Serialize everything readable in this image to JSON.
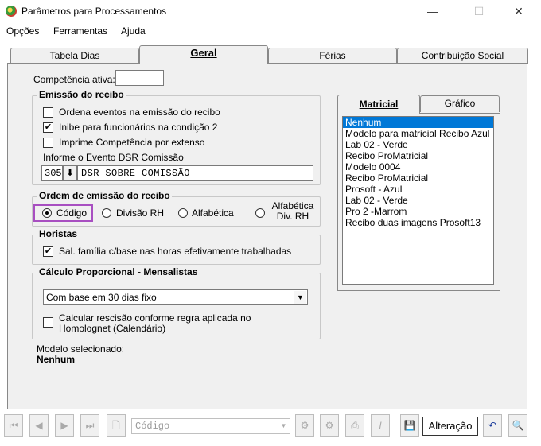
{
  "window": {
    "title": "Parâmetros para Processamentos",
    "minimize": "—",
    "maximize": "☐",
    "close": "✕"
  },
  "menu": [
    "Opções",
    "Ferramentas",
    "Ajuda"
  ],
  "tabs": [
    {
      "label": "Tabela Dias",
      "active": false
    },
    {
      "label": "Geral",
      "active": true
    },
    {
      "label": "Férias",
      "active": false
    },
    {
      "label": "Contribuição Social",
      "active": false
    }
  ],
  "competencia": {
    "label": "Competência ativa:",
    "value": ""
  },
  "emissao": {
    "title": "Emissão do recibo",
    "options": [
      {
        "label": "Ordena eventos na emissão do recibo",
        "checked": false
      },
      {
        "label": "Inibe para funcionários na condição 2",
        "checked": true
      },
      {
        "label": "Imprime Competência por extenso",
        "checked": false
      }
    ],
    "dsr_label": "Informe o Evento DSR Comissão",
    "dsr_code": "305",
    "dsr_desc": "DSR SOBRE COMISSÃO"
  },
  "ordem": {
    "title": "Ordem de emissão do recibo",
    "options": [
      {
        "label": "Código",
        "selected": true
      },
      {
        "label": "Divisão RH",
        "selected": false
      },
      {
        "label": "Alfabética",
        "selected": false
      },
      {
        "label": "Alfabética Div. RH",
        "selected": false
      }
    ]
  },
  "horistas": {
    "title": "Horistas",
    "option": {
      "label": "Sal. família c/base nas horas efetivamente trabalhadas",
      "checked": true
    }
  },
  "calculo": {
    "title": "Cálculo Proporcional - Mensalistas",
    "select_value": "Com base em 30 dias fixo",
    "option": {
      "label": "Calcular rescisão conforme regra aplicada no Homolognet (Calendário)",
      "checked": false
    }
  },
  "modelo": {
    "label": "Modelo selecionado:",
    "value": "Nenhum"
  },
  "side_tabs": [
    {
      "label": "Matricial",
      "active": true
    },
    {
      "label": "Gráfico",
      "active": false
    }
  ],
  "models": [
    "Nenhum",
    "Modelo para matricial Recibo Azul",
    "Lab 02 - Verde",
    "Recibo ProMatricial",
    "Modelo 0004",
    "Recibo ProMatricial",
    "Prosoft - Azul",
    "Lab 02 - Verde",
    "Pro 2 -Marrom",
    "Recibo duas imagens Prosoft13"
  ],
  "selected_model_index": 0,
  "toolbar": {
    "search_placeholder": "Código",
    "status": "Alteração"
  }
}
